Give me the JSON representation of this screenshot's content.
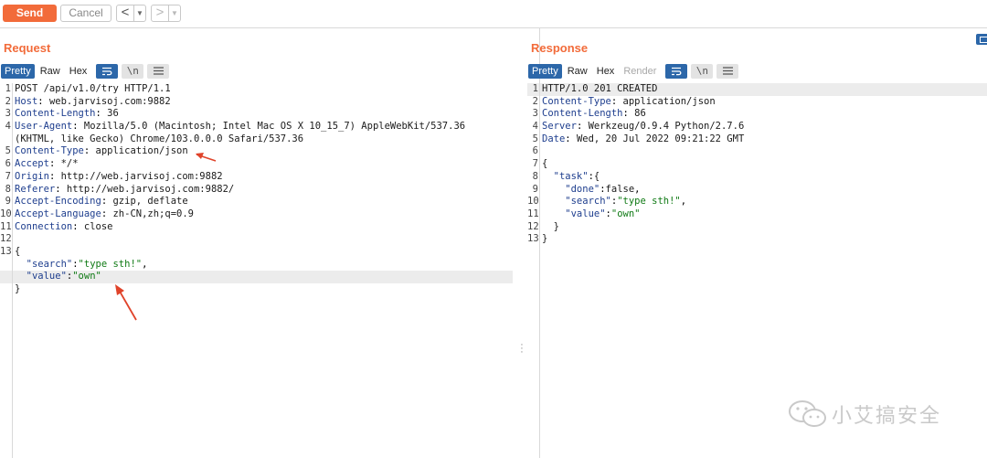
{
  "toolbar": {
    "send_label": "Send",
    "cancel_label": "Cancel",
    "back_icon": "chevron-left-icon",
    "forward_icon": "chevron-right-icon",
    "dropdown_icon": "caret-down-icon"
  },
  "request": {
    "title": "Request",
    "tabs": [
      {
        "label": "Pretty",
        "active": true
      },
      {
        "label": "Raw",
        "active": false
      },
      {
        "label": "Hex",
        "active": false
      }
    ],
    "icons": [
      "wrap-lines-icon",
      "newline-icon",
      "menu-icon"
    ],
    "newline_label": "\\n",
    "lines": [
      {
        "num": "1",
        "key": "",
        "value": "POST /api/v1.0/try HTTP/1.1"
      },
      {
        "num": "2",
        "key": "Host",
        "value": " web.jarvisoj.com:9882"
      },
      {
        "num": "3",
        "key": "Content-Length",
        "value": " 36"
      },
      {
        "num": "4",
        "key": "User-Agent",
        "value": " Mozilla/5.0 (Macintosh; Intel Mac OS X 10_15_7) AppleWebKit/537.36"
      },
      {
        "num": "",
        "key": "",
        "value": "(KHTML, like Gecko) Chrome/103.0.0.0 Safari/537.36"
      },
      {
        "num": "5",
        "key": "Content-Type",
        "value": " application/json"
      },
      {
        "num": "6",
        "key": "Accept",
        "value": " */*"
      },
      {
        "num": "7",
        "key": "Origin",
        "value": " http://web.jarvisoj.com:9882"
      },
      {
        "num": "8",
        "key": "Referer",
        "value": " http://web.jarvisoj.com:9882/"
      },
      {
        "num": "9",
        "key": "Accept-Encoding",
        "value": " gzip, deflate"
      },
      {
        "num": "10",
        "key": "Accept-Language",
        "value": " zh-CN,zh;q=0.9"
      },
      {
        "num": "11",
        "key": "Connection",
        "value": " close"
      },
      {
        "num": "12",
        "key": "",
        "value": ""
      },
      {
        "num": "13",
        "key": "",
        "value": "{"
      },
      {
        "num": "",
        "key": "  \"search\"",
        "value": "\"type sth!\"",
        "json": true,
        "trail": ","
      },
      {
        "num": "",
        "key": "  \"value\"",
        "value": "\"own\"",
        "json": true,
        "trail": "",
        "highlight": true
      },
      {
        "num": "",
        "key": "",
        "value": "}"
      }
    ]
  },
  "response": {
    "title": "Response",
    "tabs": [
      {
        "label": "Pretty",
        "active": true
      },
      {
        "label": "Raw",
        "active": false
      },
      {
        "label": "Hex",
        "active": false
      },
      {
        "label": "Render",
        "active": false,
        "disabled": true
      }
    ],
    "icons": [
      "wrap-lines-icon",
      "newline-icon",
      "menu-icon"
    ],
    "newline_label": "\\n",
    "lines": [
      {
        "num": "1",
        "key": "",
        "value": "HTTP/1.0 201 CREATED",
        "highlight": true
      },
      {
        "num": "2",
        "key": "Content-Type",
        "value": " application/json"
      },
      {
        "num": "3",
        "key": "Content-Length",
        "value": " 86"
      },
      {
        "num": "4",
        "key": "Server",
        "value": " Werkzeug/0.9.4 Python/2.7.6"
      },
      {
        "num": "5",
        "key": "Date",
        "value": " Wed, 20 Jul 2022 09:21:22 GMT"
      },
      {
        "num": "6",
        "key": "",
        "value": ""
      },
      {
        "num": "7",
        "key": "",
        "value": "{"
      },
      {
        "num": "8",
        "key": "  \"task\"",
        "value": "{",
        "json": true,
        "trail": "",
        "plain": true
      },
      {
        "num": "9",
        "key": "    \"done\"",
        "value": "false",
        "json": true,
        "trail": ",",
        "plain": true
      },
      {
        "num": "10",
        "key": "    \"search\"",
        "value": "\"type sth!\"",
        "json": true,
        "trail": ","
      },
      {
        "num": "11",
        "key": "    \"value\"",
        "value": "\"own\"",
        "json": true,
        "trail": ""
      },
      {
        "num": "12",
        "key": "",
        "value": "  }"
      },
      {
        "num": "13",
        "key": "",
        "value": "}"
      }
    ]
  },
  "watermark": {
    "text": "小艾搞安全",
    "icon": "wechat-icon"
  },
  "colors": {
    "accent": "#f26b3a",
    "active_tab": "#2c67a9",
    "key": "#1e3e8e",
    "string": "#0f7a14",
    "annotation_arrow": "#e0432a"
  }
}
